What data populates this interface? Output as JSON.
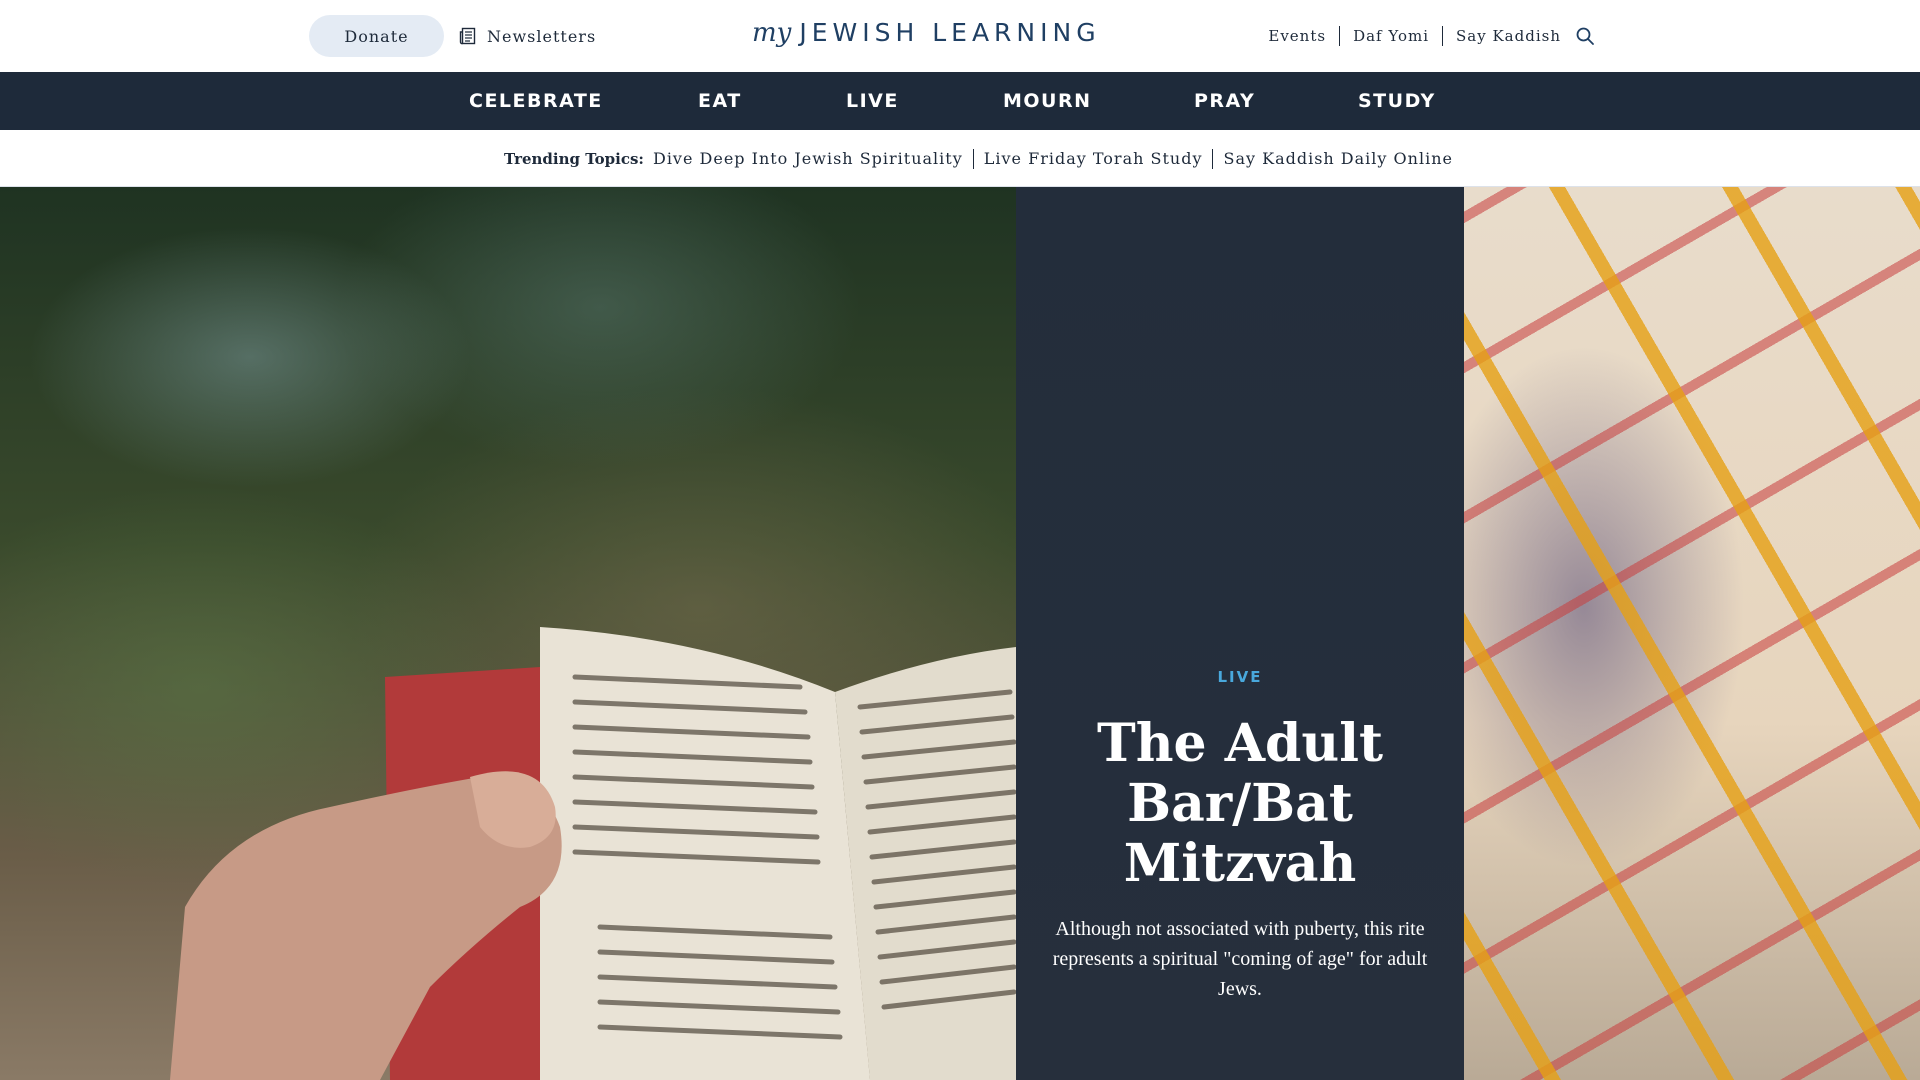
{
  "topbar": {
    "donate_label": "Donate",
    "newsletters_label": "Newsletters",
    "logo_my": "my",
    "logo_main": "JEWISH LEARNING",
    "links": [
      "Events",
      "Daf Yomi",
      "Say Kaddish"
    ]
  },
  "nav": {
    "items": [
      "CELEBRATE",
      "EAT",
      "LIVE",
      "MOURN",
      "PRAY",
      "STUDY"
    ]
  },
  "trending": {
    "label": "Trending Topics:",
    "links": [
      "Dive Deep Into Jewish Spirituality",
      "Live Friday Torah Study",
      "Say Kaddish Daily Online"
    ]
  },
  "hero": {
    "category": "LIVE",
    "title": "The Adult Bar/Bat Mitzvah",
    "description": "Although not associated with puberty, this rite represents a spiritual \"coming of age\" for adult Jews."
  },
  "colors": {
    "nav_bg": "#1e2a3a",
    "panel_bg": "#252e3b",
    "accent_blue": "#49a8dc",
    "logo_blue": "#1f3f63",
    "donate_bg": "#e4ebf4"
  }
}
